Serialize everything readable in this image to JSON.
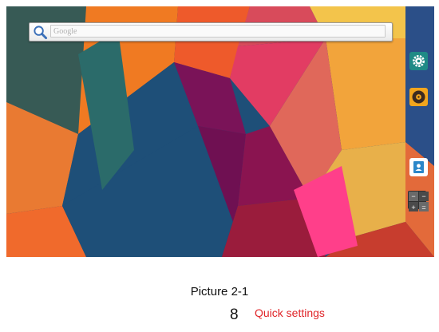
{
  "search": {
    "placeholder": "Google",
    "icon": "search-icon"
  },
  "side_icons": [
    "settings-icon",
    "music-player-icon",
    "contacts-icon",
    "calculator-icon"
  ],
  "caption": "Picture 2-1",
  "page_number": "8",
  "section_title": "Quick settings",
  "colors": {
    "section_title": "#e0262a",
    "settings_bg": "#1f8a86",
    "music_bg": "#f2a51d"
  }
}
